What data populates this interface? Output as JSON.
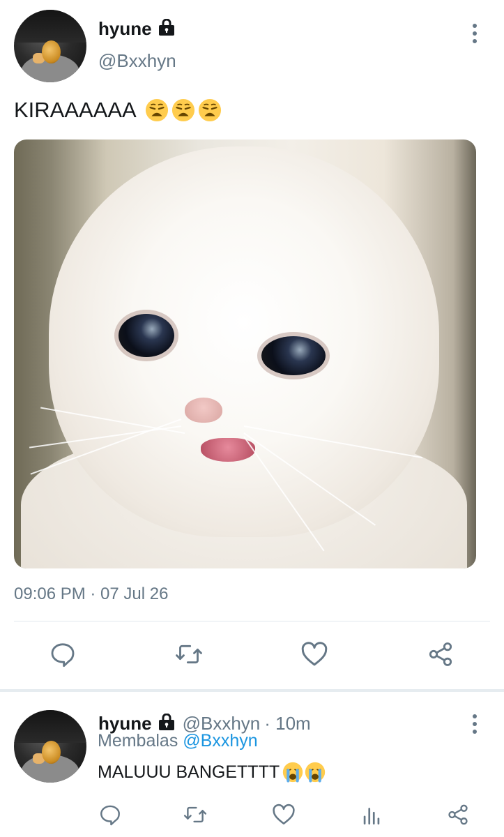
{
  "tweet": {
    "display_name": "hyune",
    "handle": "@Bxxhyn",
    "text": "KIRAAAAAA",
    "emojis": [
      "weary-face-emoji",
      "weary-face-emoji",
      "weary-face-emoji"
    ],
    "media": "crying-white-cat-photo",
    "timestamp": "09:06 PM · 07 Jul 26",
    "actions": [
      "reply-icon",
      "retweet-icon",
      "like-icon",
      "share-icon"
    ]
  },
  "reply": {
    "display_name": "hyune",
    "handle": "@Bxxhyn",
    "time_ago": "· 10m",
    "replying_label": "Membalas",
    "replying_to": "@Bxxhyn",
    "text": "MALUUU BANGETTTT",
    "emojis": [
      "loudly-crying-face-emoji",
      "loudly-crying-face-emoji"
    ],
    "actions": [
      "reply-icon",
      "retweet-icon",
      "like-icon",
      "analytics-icon",
      "share-icon"
    ]
  },
  "colors": {
    "text": "#14171a",
    "secondary": "#657786",
    "link": "#1b95e0",
    "divider": "#e1e8ed",
    "background": "#ffffff"
  }
}
